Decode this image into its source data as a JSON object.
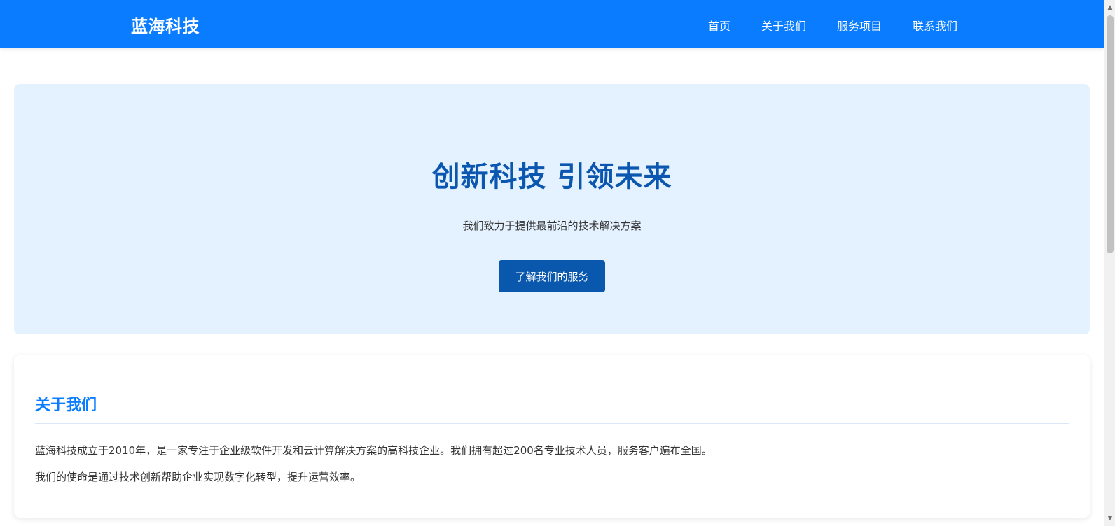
{
  "header": {
    "brand": "蓝海科技",
    "nav": [
      {
        "label": "首页"
      },
      {
        "label": "关于我们"
      },
      {
        "label": "服务项目"
      },
      {
        "label": "联系我们"
      }
    ]
  },
  "hero": {
    "title": "创新科技 引领未来",
    "subtitle": "我们致力于提供最前沿的技术解决方案",
    "button_label": "了解我们的服务"
  },
  "about": {
    "title": "关于我们",
    "paragraphs": [
      "蓝海科技成立于2010年，是一家专注于企业级软件开发和云计算解决方案的高科技企业。我们拥有超过200名专业技术人员，服务客户遍布全国。",
      "我们的使命是通过技术创新帮助企业实现数字化转型，提升运营效率。"
    ]
  },
  "scrollbar": {
    "up_icon": "▲",
    "down_icon": "▼"
  },
  "colors": {
    "header_bg": "#0a7cff",
    "hero_bg": "#e4f1ff",
    "hero_title": "#0b57b0",
    "button_bg": "#0a57ae",
    "about_title": "#0a7cff"
  }
}
